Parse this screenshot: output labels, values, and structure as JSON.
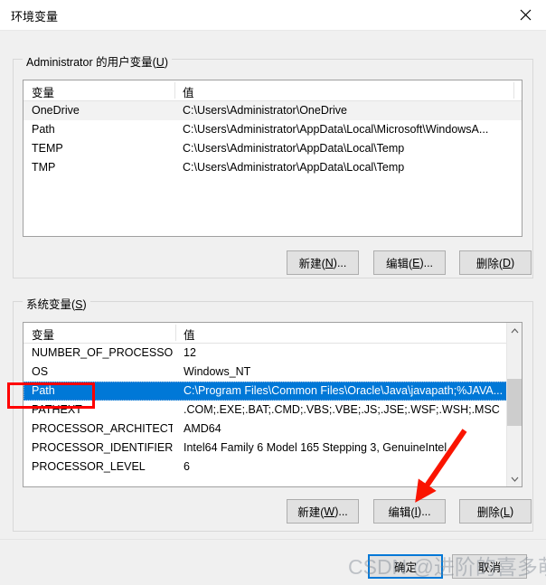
{
  "window": {
    "title": "环境变量",
    "close_icon": "close-icon"
  },
  "user_section": {
    "legend_prefix": "Administrator 的用户变量(",
    "legend_accel": "U",
    "legend_suffix": ")",
    "columns": [
      "变量",
      "值"
    ],
    "rows": [
      {
        "name": "OneDrive",
        "value": "C:\\Users\\Administrator\\OneDrive"
      },
      {
        "name": "Path",
        "value": "C:\\Users\\Administrator\\AppData\\Local\\Microsoft\\WindowsA..."
      },
      {
        "name": "TEMP",
        "value": "C:\\Users\\Administrator\\AppData\\Local\\Temp"
      },
      {
        "name": "TMP",
        "value": "C:\\Users\\Administrator\\AppData\\Local\\Temp"
      }
    ],
    "buttons": [
      {
        "prefix": "新建(",
        "accel": "N",
        "suffix": ")..."
      },
      {
        "prefix": "编辑(",
        "accel": "E",
        "suffix": ")..."
      },
      {
        "prefix": "删除(",
        "accel": "D",
        "suffix": ")"
      }
    ]
  },
  "system_section": {
    "legend_prefix": "系统变量(",
    "legend_accel": "S",
    "legend_suffix": ")",
    "columns": [
      "变量",
      "值"
    ],
    "rows": [
      {
        "name": "NUMBER_OF_PROCESSORS",
        "value": "12",
        "selected": false
      },
      {
        "name": "OS",
        "value": "Windows_NT",
        "selected": false
      },
      {
        "name": "Path",
        "value": "C:\\Program Files\\Common Files\\Oracle\\Java\\javapath;%JAVA...",
        "selected": true
      },
      {
        "name": "PATHEXT",
        "value": ".COM;.EXE;.BAT;.CMD;.VBS;.VBE;.JS;.JSE;.WSF;.WSH;.MSC",
        "selected": false
      },
      {
        "name": "PROCESSOR_ARCHITECT...",
        "value": "AMD64",
        "selected": false
      },
      {
        "name": "PROCESSOR_IDENTIFIER",
        "value": "Intel64 Family 6 Model 165 Stepping 3, GenuineIntel",
        "selected": false
      },
      {
        "name": "PROCESSOR_LEVEL",
        "value": "6",
        "selected": false
      }
    ],
    "buttons": [
      {
        "prefix": "新建(",
        "accel": "W",
        "suffix": ")..."
      },
      {
        "prefix": "编辑(",
        "accel": "I",
        "suffix": ")..."
      },
      {
        "prefix": "删除(",
        "accel": "L",
        "suffix": ")"
      }
    ],
    "scrollbar": {
      "up_arrow": "^",
      "down_arrow": "v"
    }
  },
  "dialog_buttons": {
    "ok": "确定",
    "cancel": "取消"
  },
  "annotations": {
    "highlight_target": "Path",
    "arrow_target": "编辑(I)...",
    "watermark_text": "CSDN @进阶的喜多萌~"
  },
  "colors": {
    "selection": "#0078d7",
    "annotation": "#ff0000",
    "dialog_bg": "#f0f0f0",
    "list_bg": "#ffffff"
  }
}
